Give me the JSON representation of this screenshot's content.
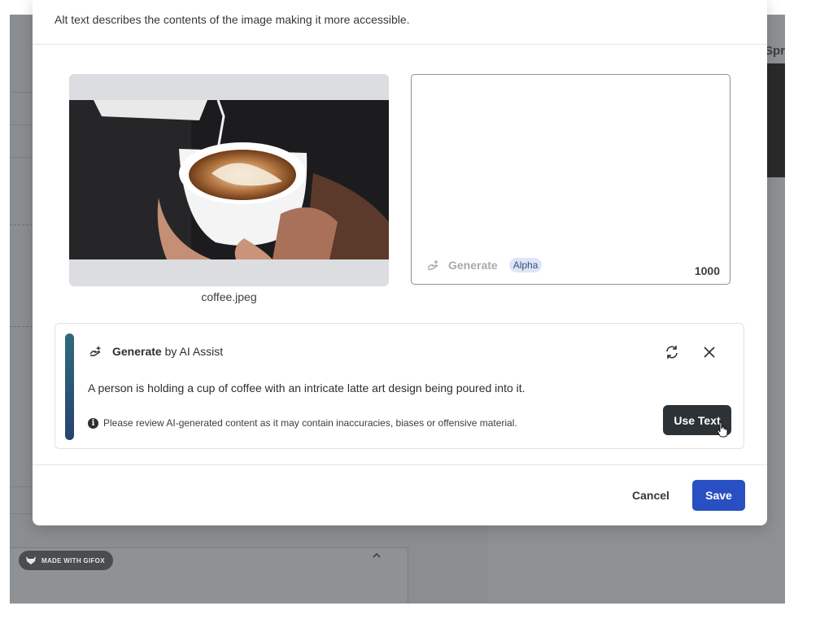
{
  "modal": {
    "description": "Alt text describes the contents of the image making it more accessible.",
    "image": {
      "filename": "coffee.jpeg",
      "alt_icon": "coffee-photo"
    },
    "alt_text_field": {
      "value": "",
      "generate_label": "Generate",
      "badge": "Alpha",
      "char_limit": "1000"
    },
    "ai_assist": {
      "title_bold": "Generate",
      "title_rest": "by AI Assist",
      "generated_text": "A person is holding a cup of coffee with an intricate latte art design being poured into it.",
      "warning": "Please review AI-generated content as it may contain inaccuracies, biases or offensive material.",
      "use_text_label": "Use Text"
    },
    "footer": {
      "cancel_label": "Cancel",
      "save_label": "Save"
    }
  },
  "backdrop": {
    "partial_heading": "Spr",
    "gifox_badge": "MADE WITH GIFOX"
  },
  "colors": {
    "primary": "#2950c2",
    "dark_button": "#2c3235",
    "ai_accent": "#2f6b7a",
    "badge_bg": "#dde5f7"
  }
}
